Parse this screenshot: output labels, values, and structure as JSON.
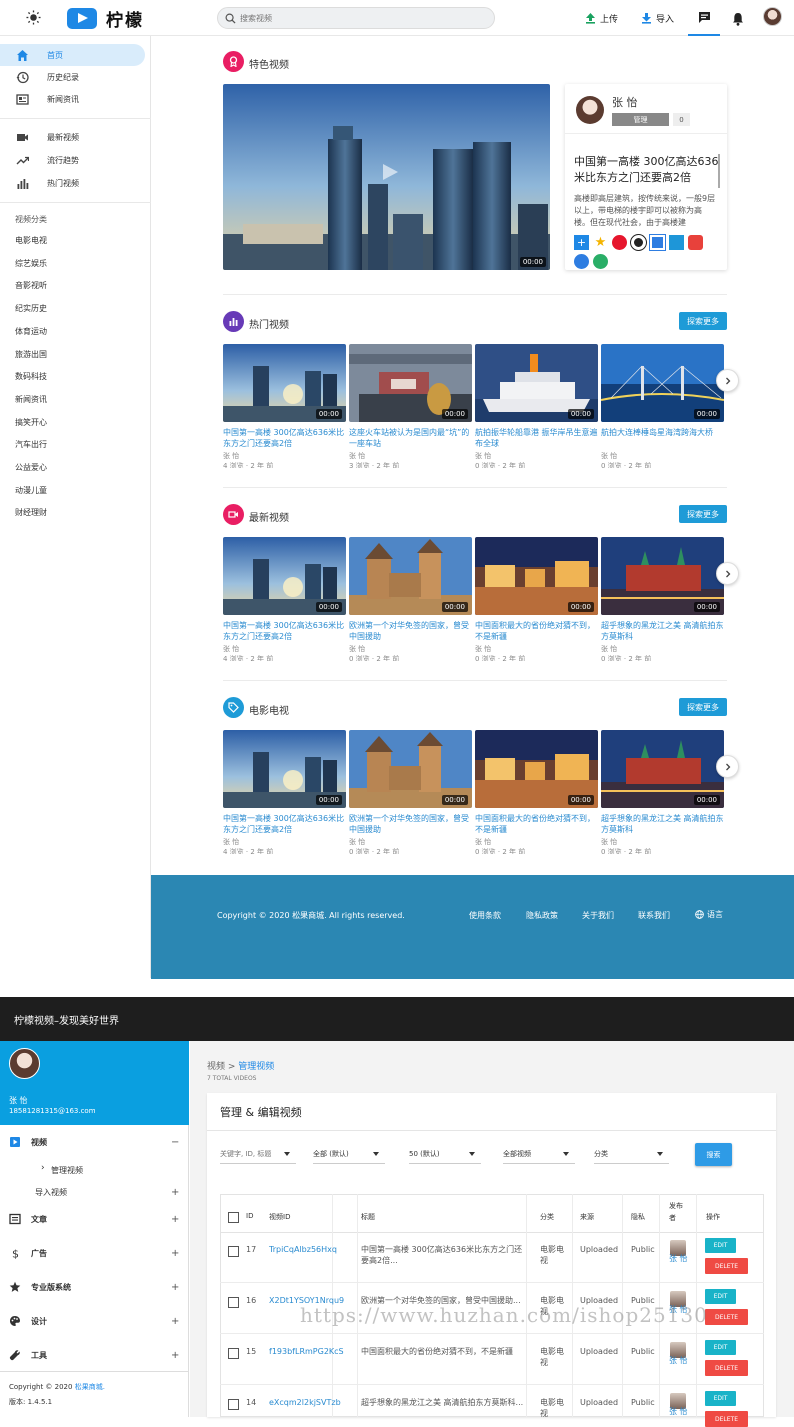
{
  "header": {
    "logo": "柠檬",
    "search_placeholder": "搜索视频",
    "upload": "上传",
    "import": "导入"
  },
  "sidebar": {
    "main": [
      {
        "label": "首页",
        "icon": "home-icon"
      },
      {
        "label": "历史纪录",
        "icon": "history-icon"
      },
      {
        "label": "新闻资讯",
        "icon": "news-icon"
      }
    ],
    "second": [
      {
        "label": "最新视频",
        "icon": "video-camera-icon"
      },
      {
        "label": "流行趋势",
        "icon": "trending-icon"
      },
      {
        "label": "热门视频",
        "icon": "bar-chart-icon"
      }
    ],
    "category_title": "视频分类",
    "categories": [
      "电影电视",
      "综艺娱乐",
      "音影视听",
      "纪实历史",
      "体育运动",
      "旅游出国",
      "数码科技",
      "新闻资讯",
      "搞笑开心",
      "汽车出行",
      "公益爱心",
      "动漫儿童",
      "财经理财"
    ]
  },
  "featured": {
    "title": "特色视频",
    "duration": "00:00",
    "user": "张 怡",
    "badge": "管理",
    "count": "0",
    "headline": "中国第一高楼 300亿高达636米比东方之门还要高2倍",
    "excerpt": "高楼即高层建筑，按传统来说，一般9层以上，带电梯的楼宇即可以被称为高楼。但在现代社会，由于高楼建"
  },
  "sections": [
    {
      "title": "热门视频",
      "more": "探索更多",
      "videos": [
        {
          "title": "中国第一高楼 300亿高达636米比东方之门还要高2倍",
          "author": "张 怡",
          "meta": "4 浏览 · 2 年 前",
          "duration": "00:00"
        },
        {
          "title": "这座火车站被认为是国内最“坑”的一座车站",
          "author": "张 怡",
          "meta": "3 浏览 · 2 年 前",
          "duration": "00:00"
        },
        {
          "title": "航拍振华轮船靠港 振华岸吊生意遍布全球",
          "author": "张 怡",
          "meta": "0 浏览 · 2 年 前",
          "duration": "00:00"
        },
        {
          "title": "航拍大连棒棰岛星海湾跨海大桥",
          "author": "张 怡",
          "meta": "0 浏览 · 2 年 前",
          "duration": "00:00"
        }
      ]
    },
    {
      "title": "最新视频",
      "more": "探索更多",
      "videos": [
        {
          "title": "中国第一高楼 300亿高达636米比东方之门还要高2倍",
          "author": "张 怡",
          "meta": "4 浏览 · 2 年 前",
          "duration": "00:00"
        },
        {
          "title": "欧洲第一个对华免签的国家，曾受中国援助",
          "author": "张 怡",
          "meta": "0 浏览 · 2 年 前",
          "duration": "00:00"
        },
        {
          "title": "中国面积最大的省份绝对猜不到，不是新疆",
          "author": "张 怡",
          "meta": "0 浏览 · 2 年 前",
          "duration": "00:00"
        },
        {
          "title": "超乎想象的黑龙江之美 高清航拍东方莫斯科",
          "author": "张 怡",
          "meta": "0 浏览 · 2 年 前",
          "duration": "00:00"
        }
      ]
    },
    {
      "title": "电影电视",
      "more": "探索更多",
      "videos": [
        {
          "title": "中国第一高楼 300亿高达636米比东方之门还要高2倍",
          "author": "张 怡",
          "meta": "4 浏览 · 2 年 前",
          "duration": "00:00"
        },
        {
          "title": "欧洲第一个对华免签的国家，曾受中国援助",
          "author": "张 怡",
          "meta": "0 浏览 · 2 年 前",
          "duration": "00:00"
        },
        {
          "title": "中国面积最大的省份绝对猜不到，不是新疆",
          "author": "张 怡",
          "meta": "0 浏览 · 2 年 前",
          "duration": "00:00"
        },
        {
          "title": "超乎想象的黑龙江之美 高清航拍东方莫斯科",
          "author": "张 怡",
          "meta": "0 浏览 · 2 年 前",
          "duration": "00:00"
        }
      ]
    }
  ],
  "footer": {
    "copyright": "Copyright © 2020 松果商城. All rights reserved.",
    "links": [
      "使用条款",
      "隐私政策",
      "关于我们",
      "联系我们"
    ],
    "language": "语言"
  },
  "admin": {
    "topbar_title": "柠檬视频–发现美好世界",
    "user_name": "张 怡",
    "user_email": "18581281315@163.com",
    "menu": [
      {
        "label": "视频",
        "toggle": "−"
      },
      {
        "label": "管理视频",
        "toggle": ""
      },
      {
        "label": "导入视频",
        "toggle": "+"
      },
      {
        "label": "文章",
        "toggle": "+"
      },
      {
        "label": "广告",
        "toggle": "+"
      },
      {
        "label": "专业版系统",
        "toggle": "+"
      },
      {
        "label": "设计",
        "toggle": "+"
      },
      {
        "label": "工具",
        "toggle": "+"
      }
    ],
    "copyright_prefix": "Copyright © 2020 ",
    "copyright_link": "松果商城.",
    "version": "版本: 1.4.5.1",
    "breadcrumb_root": "视频",
    "breadcrumb_sep": " > ",
    "breadcrumb_current": "管理视频",
    "total": "7 TOTAL VIDEOS",
    "panel_title": "管理 & 编辑视频",
    "filter_placeholder": "关键字, ID, 标题",
    "filters": [
      "全部 (默认)",
      "50 (默认)",
      "全部视频",
      "分类"
    ],
    "search_btn": "搜索",
    "columns": [
      "ID",
      "视频ID",
      "标题",
      "分类",
      "来源",
      "隐私",
      "发布者",
      "操作"
    ],
    "rows": [
      {
        "id": "17",
        "vid": "TrpiCqAlbz56Hxq",
        "title": "中国第一高楼 300亿高达636米比东方之门还要高2倍...",
        "cat": "电影电视",
        "src": "Uploaded",
        "privacy": "Public",
        "author": "张 怡"
      },
      {
        "id": "16",
        "vid": "X2Dt1YSOY1Nrqu9",
        "title": "欧洲第一个对华免签的国家，曾受中国援助...",
        "cat": "电影电视",
        "src": "Uploaded",
        "privacy": "Public",
        "author": "张 怡"
      },
      {
        "id": "15",
        "vid": "f193bfLRmPG2KcS",
        "title": "中国面积最大的省份绝对猜不到，不是新疆",
        "cat": "电影电视",
        "src": "Uploaded",
        "privacy": "Public",
        "author": "张 怡"
      },
      {
        "id": "14",
        "vid": "eXcqm2l2kjSVTzb",
        "title": "超乎想象的黑龙江之美 高清航拍东方莫斯科...",
        "cat": "电影电视",
        "src": "Uploaded",
        "privacy": "Public",
        "author": "张 怡"
      }
    ],
    "edit": "EDIT",
    "delete": "DELETE"
  },
  "watermark": "https://www.huzhan.com/ishop25130"
}
